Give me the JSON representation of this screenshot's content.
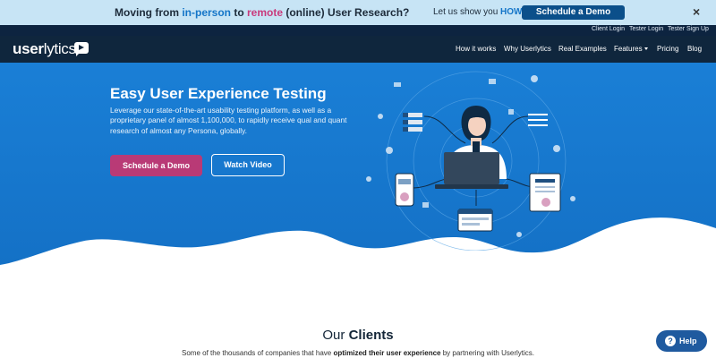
{
  "promo": {
    "prefix": "Moving from ",
    "in_person": "in-person",
    "middle": " to ",
    "remote": "remote",
    "suffix": " (online) User Research?",
    "cta_text": "Let us show you ",
    "cta_how": "HOW!",
    "button": "Schedule a Demo",
    "close": "×"
  },
  "util_links": [
    "Client Login",
    "Tester Login",
    "Tester Sign Up"
  ],
  "nav": {
    "logo_bold": "user",
    "logo_light": "lytics",
    "items": [
      "How it works",
      "Why Userlytics",
      "Real Examples",
      "Features",
      "Pricing",
      "Blog"
    ]
  },
  "hero": {
    "title": "Easy User Experience Testing",
    "description": "Leverage our state-of-the-art usability testing platform, as well as a proprietary panel of almost 1,100,000, to rapidly receive qual and quant research of almost any Persona, globally.",
    "demo_button": "Schedule a Demo",
    "video_button": "Watch Video"
  },
  "clients": {
    "title_light": "Our ",
    "title_bold": "Clients",
    "sub_prefix": "Some of the thousands of companies that have ",
    "sub_bold": "optimized their user experience",
    "sub_suffix": " by partnering with Userlytics."
  },
  "help": {
    "icon": "?",
    "label": "Help"
  },
  "colors": {
    "hero_blue": "#1478d2",
    "nav_dark": "#0f263d",
    "promo_bg": "#c7e4f5",
    "demo_pink": "#b93a76",
    "help_blue": "#1f5a9f"
  }
}
